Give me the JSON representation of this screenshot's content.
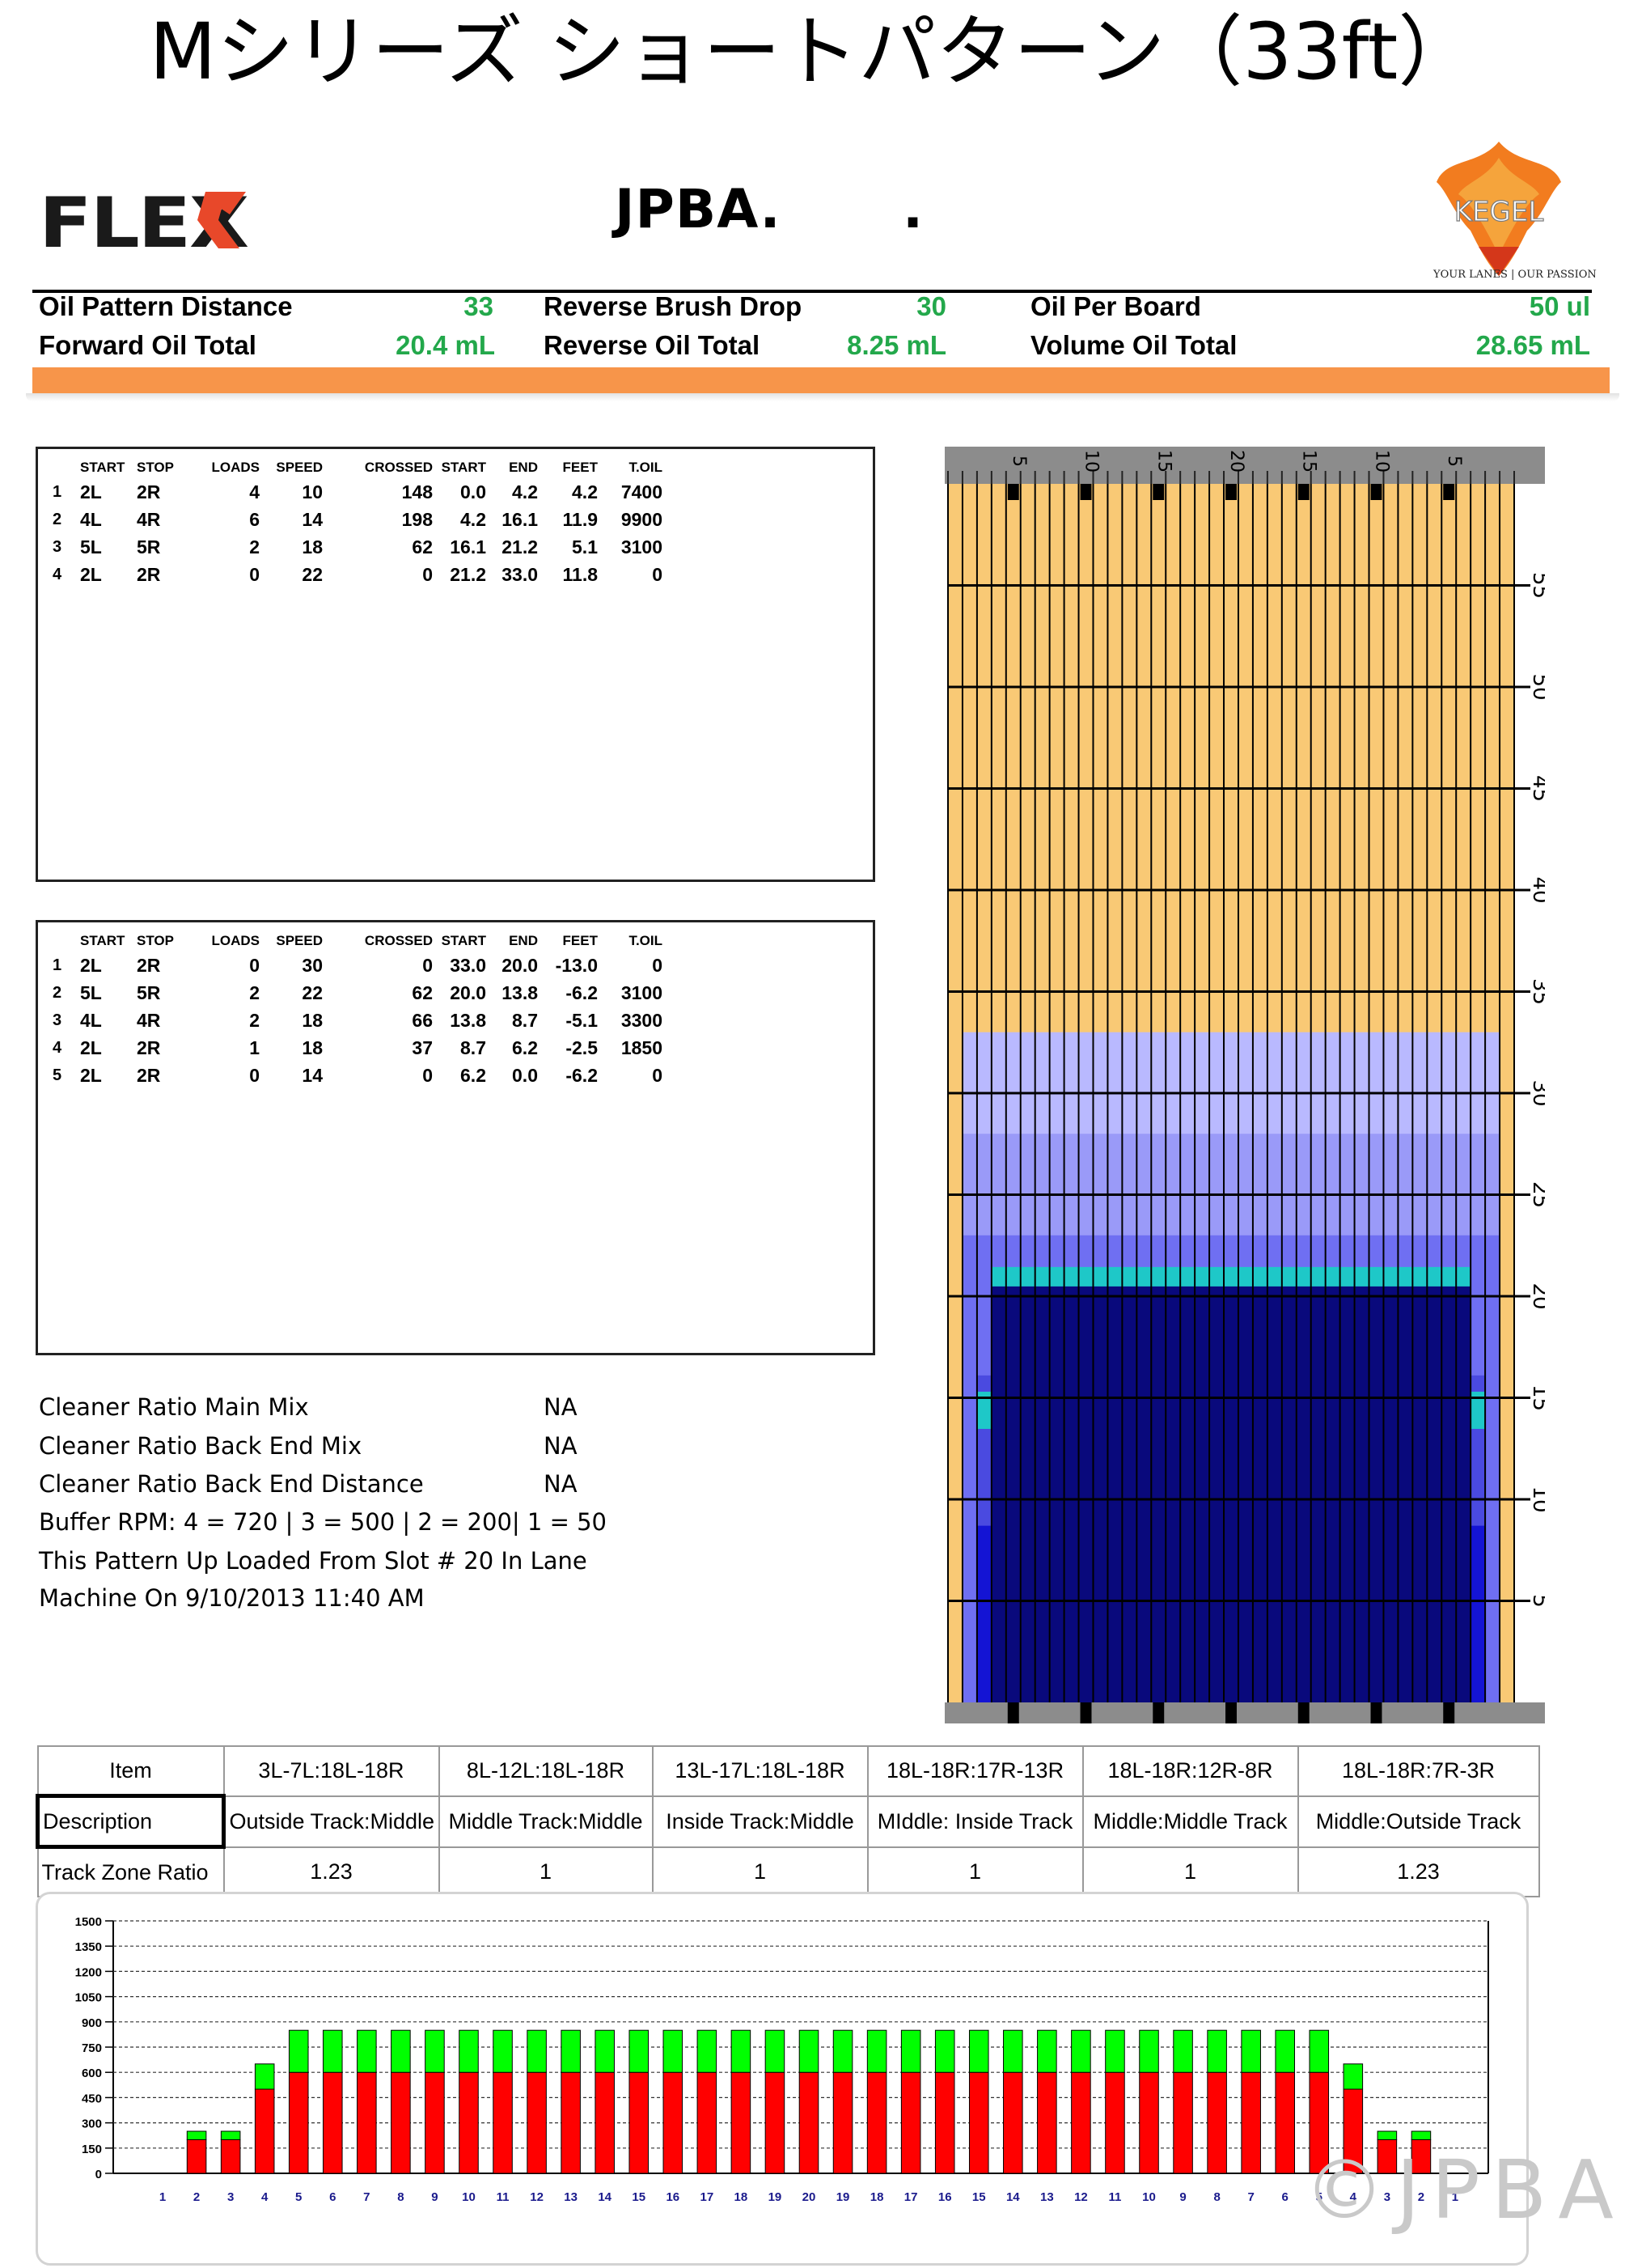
{
  "title": "Mシリーズ ショートパターン（33ft）",
  "header": {
    "brand": "FLEX",
    "center_title": "JPBA.",
    "center_dot": ".",
    "kegel_logo_text": "KEGEL",
    "kegel_tagline": "YOUR LANES | OUR PASSION"
  },
  "stats": [
    {
      "label": "Oil Pattern Distance",
      "value": "33"
    },
    {
      "label": "Reverse Brush Drop",
      "value": "30"
    },
    {
      "label": "Oil Per Board",
      "value": "50 ul"
    },
    {
      "label": "Forward Oil Total",
      "value": "20.4 mL"
    },
    {
      "label": "Reverse Oil Total",
      "value": "8.25 mL"
    },
    {
      "label": "Volume Oil Total",
      "value": "28.65 mL"
    }
  ],
  "pass_headers": [
    "",
    "START",
    "STOP",
    "LOADS",
    "SPEED",
    "CROSSED",
    "START",
    "END",
    "FEET",
    "T.OIL"
  ],
  "forward_passes": [
    [
      "1",
      "2L",
      "2R",
      "4",
      "10",
      "148",
      "0.0",
      "4.2",
      "4.2",
      "7400"
    ],
    [
      "2",
      "4L",
      "4R",
      "6",
      "14",
      "198",
      "4.2",
      "16.1",
      "11.9",
      "9900"
    ],
    [
      "3",
      "5L",
      "5R",
      "2",
      "18",
      "62",
      "16.1",
      "21.2",
      "5.1",
      "3100"
    ],
    [
      "4",
      "2L",
      "2R",
      "0",
      "22",
      "0",
      "21.2",
      "33.0",
      "11.8",
      "0"
    ]
  ],
  "reverse_passes": [
    [
      "1",
      "2L",
      "2R",
      "0",
      "30",
      "0",
      "33.0",
      "20.0",
      "-13.0",
      "0"
    ],
    [
      "2",
      "5L",
      "5R",
      "2",
      "22",
      "62",
      "20.0",
      "13.8",
      "-6.2",
      "3100"
    ],
    [
      "3",
      "4L",
      "4R",
      "2",
      "18",
      "66",
      "13.8",
      "8.7",
      "-5.1",
      "3300"
    ],
    [
      "4",
      "2L",
      "2R",
      "1",
      "18",
      "37",
      "8.7",
      "6.2",
      "-2.5",
      "1850"
    ],
    [
      "5",
      "2L",
      "2R",
      "0",
      "14",
      "0",
      "6.2",
      "0.0",
      "-6.2",
      "0"
    ]
  ],
  "notes": {
    "cleaner_main_label": "Cleaner Ratio Main Mix",
    "cleaner_main_value": "NA",
    "cleaner_back_label": "Cleaner Ratio Back End Mix",
    "cleaner_back_value": "NA",
    "cleaner_dist_label": "Cleaner Ratio Back End Distance",
    "cleaner_dist_value": "NA",
    "buffer_rpm": "Buffer RPM: 4 = 720 | 3 = 500 | 2 = 200| 1 = 50",
    "loaded_line1": "This Pattern Up Loaded From Slot # 20 In Lane",
    "loaded_line2": "Machine On 9/10/2013 11:40 AM"
  },
  "lane": {
    "top_labels": [
      "5",
      "10",
      "15",
      "20",
      "15",
      "10",
      "5"
    ],
    "side_labels": [
      "55",
      "50",
      "45",
      "40",
      "35",
      "30",
      "25",
      "20",
      "15",
      "10",
      "5"
    ],
    "colors": {
      "dry": "#f9c975",
      "light": "#b9b9ff",
      "medium": "#6f6ff2",
      "dark": "#09097c",
      "bright": "#1414d4",
      "cyan": "#1ec8c8",
      "gray": "#8c8c8c"
    }
  },
  "zone_table": {
    "headers": [
      "Item",
      "3L-7L:18L-18R",
      "8L-12L:18L-18R",
      "13L-17L:18L-18R",
      "18L-18R:17R-13R",
      "18L-18R:12R-8R",
      "18L-18R:7R-3R"
    ],
    "description": [
      "Description",
      "Outside Track:Middle",
      "Middle Track:Middle",
      "Inside Track:Middle",
      "MIddle: Inside Track",
      "Middle:Middle Track",
      "Middle:Outside Track"
    ],
    "ratio": [
      "Track Zone Ratio",
      "1.23",
      "1",
      "1",
      "1",
      "1",
      "1.23"
    ]
  },
  "chart_data": {
    "type": "bar",
    "stacked": true,
    "categories": [
      "1",
      "2",
      "3",
      "4",
      "5",
      "6",
      "7",
      "8",
      "9",
      "10",
      "11",
      "12",
      "13",
      "14",
      "15",
      "16",
      "17",
      "18",
      "19",
      "20",
      "19",
      "18",
      "17",
      "16",
      "15",
      "14",
      "13",
      "12",
      "11",
      "10",
      "9",
      "8",
      "7",
      "6",
      "5",
      "4",
      "3",
      "2",
      "1"
    ],
    "series": [
      {
        "color": "#ff0000",
        "values": [
          0,
          200,
          200,
          500,
          600,
          600,
          600,
          600,
          600,
          600,
          600,
          600,
          600,
          600,
          600,
          600,
          600,
          600,
          600,
          600,
          600,
          600,
          600,
          600,
          600,
          600,
          600,
          600,
          600,
          600,
          600,
          600,
          600,
          600,
          600,
          500,
          200,
          200,
          0
        ]
      },
      {
        "color": "#00ff00",
        "values": [
          0,
          50,
          50,
          150,
          250,
          250,
          250,
          250,
          250,
          250,
          250,
          250,
          250,
          250,
          250,
          250,
          250,
          250,
          250,
          250,
          250,
          250,
          250,
          250,
          250,
          250,
          250,
          250,
          250,
          250,
          250,
          250,
          250,
          250,
          250,
          150,
          50,
          50,
          0
        ]
      }
    ],
    "yticks": [
      0,
      150,
      300,
      450,
      600,
      750,
      900,
      1050,
      1200,
      1350,
      1500
    ],
    "ylim": [
      0,
      1500
    ],
    "grid": true
  },
  "watermark": "©JPBA"
}
